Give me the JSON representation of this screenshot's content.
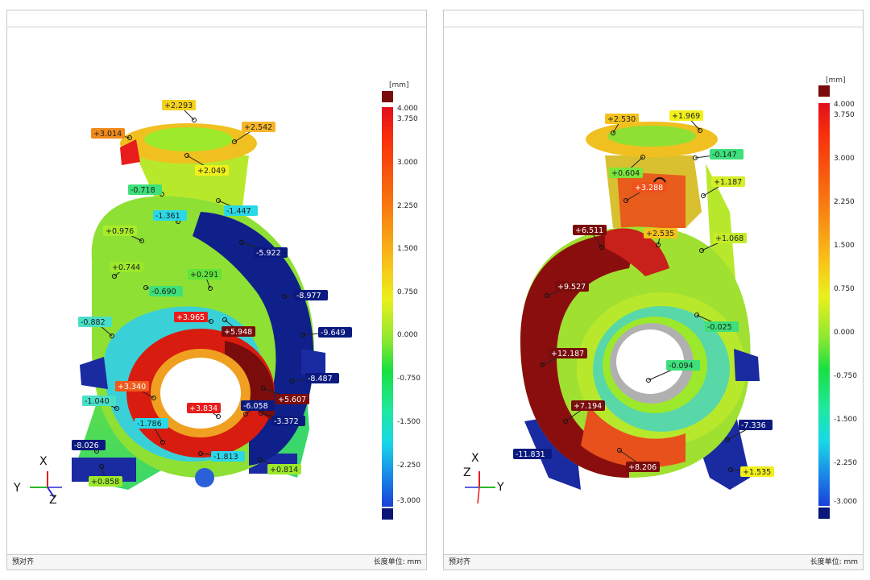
{
  "panels": [
    {
      "footer_left": "预对齐",
      "footer_right": "长度单位: mm",
      "scale": {
        "unit": "[mm]",
        "ticks": [
          "4.000",
          "3.750",
          "3.000",
          "2.250",
          "1.500",
          "0.750",
          "0.000",
          "-0.750",
          "-1.500",
          "-2.250",
          "-3.000"
        ]
      },
      "axes": {
        "up": "X",
        "left": "Y",
        "right": "Z"
      },
      "labels": [
        {
          "text": "+2.293",
          "c": "#f4d21c",
          "tc": "#222"
        },
        {
          "text": "+3.014",
          "c": "#f08a1c",
          "tc": "#222"
        },
        {
          "text": "+2.542",
          "c": "#f6b52a",
          "tc": "#222"
        },
        {
          "text": "+2.049",
          "c": "#f2f01c",
          "tc": "#222"
        },
        {
          "text": "-0.718",
          "c": "#3de07a",
          "tc": "#222"
        },
        {
          "text": "-1.361",
          "c": "#2ad8e8",
          "tc": "#222"
        },
        {
          "text": "-1.447",
          "c": "#2ad8e8",
          "tc": "#222"
        },
        {
          "text": "+0.976",
          "c": "#a8ec2a",
          "tc": "#222"
        },
        {
          "text": "-5.922",
          "c": "#0c1a80",
          "tc": "#fff"
        },
        {
          "text": "+0.744",
          "c": "#9ce82a",
          "tc": "#222"
        },
        {
          "text": "+0.291",
          "c": "#62e43a",
          "tc": "#222"
        },
        {
          "text": "-0.690",
          "c": "#3de07a",
          "tc": "#222"
        },
        {
          "text": "-8.977",
          "c": "#0c1a80",
          "tc": "#fff"
        },
        {
          "text": "-0.882",
          "c": "#48dfc8",
          "tc": "#222"
        },
        {
          "text": "+3.965",
          "c": "#e81c1c",
          "tc": "#fff"
        },
        {
          "text": "+5.948",
          "c": "#7a0c0c",
          "tc": "#fff"
        },
        {
          "text": "-9.649",
          "c": "#0c1a80",
          "tc": "#fff"
        },
        {
          "text": "-8.487",
          "c": "#0c1a80",
          "tc": "#fff"
        },
        {
          "text": "+3.340",
          "c": "#f05a1c",
          "tc": "#fff"
        },
        {
          "text": "+5.607",
          "c": "#7a0c0c",
          "tc": "#fff"
        },
        {
          "text": "-1.040",
          "c": "#48dfc8",
          "tc": "#222"
        },
        {
          "text": "+3.834",
          "c": "#e81c1c",
          "tc": "#fff"
        },
        {
          "text": "-6.058",
          "c": "#0c1a80",
          "tc": "#fff"
        },
        {
          "text": "-3.372",
          "c": "#0c1a80",
          "tc": "#fff"
        },
        {
          "text": "-1.786",
          "c": "#2ad8e8",
          "tc": "#222"
        },
        {
          "text": "-8.026",
          "c": "#0c1a80",
          "tc": "#fff"
        },
        {
          "text": "-1.813",
          "c": "#2ad8e8",
          "tc": "#222"
        },
        {
          "text": "+0.814",
          "c": "#9ce82a",
          "tc": "#222"
        },
        {
          "text": "+0.858",
          "c": "#9ce82a",
          "tc": "#222"
        }
      ]
    },
    {
      "footer_left": "预对齐",
      "footer_right": "长度单位: mm",
      "scale": {
        "unit": "[mm]",
        "ticks": [
          "4.000",
          "3.750",
          "3.000",
          "2.250",
          "1.500",
          "0.750",
          "0.000",
          "-0.750",
          "-1.500",
          "-2.250",
          "-3.000"
        ]
      },
      "axes": {
        "up": "X",
        "left": "Z",
        "right": "Y"
      },
      "labels": [
        {
          "text": "+2.530",
          "c": "#f4c21c",
          "tc": "#222"
        },
        {
          "text": "+1.969",
          "c": "#f2f01c",
          "tc": "#222"
        },
        {
          "text": "-0.147",
          "c": "#3de07a",
          "tc": "#222"
        },
        {
          "text": "+0.604",
          "c": "#7ae63a",
          "tc": "#222"
        },
        {
          "text": "+3.288",
          "c": "#f0501c",
          "tc": "#fff"
        },
        {
          "text": "+1.187",
          "c": "#d6ee2a",
          "tc": "#222"
        },
        {
          "text": "+6.511",
          "c": "#7a0c0c",
          "tc": "#fff"
        },
        {
          "text": "+2.535",
          "c": "#f4c21c",
          "tc": "#222"
        },
        {
          "text": "+1.068",
          "c": "#c4ec2a",
          "tc": "#222"
        },
        {
          "text": "+9.527",
          "c": "#7a0c0c",
          "tc": "#fff"
        },
        {
          "text": "-0.025",
          "c": "#3de07a",
          "tc": "#222"
        },
        {
          "text": "+12.187",
          "c": "#7a0c0c",
          "tc": "#fff"
        },
        {
          "text": "-0.094",
          "c": "#3de07a",
          "tc": "#222"
        },
        {
          "text": "+7.194",
          "c": "#7a0c0c",
          "tc": "#fff"
        },
        {
          "text": "-7.336",
          "c": "#0c1a80",
          "tc": "#fff"
        },
        {
          "text": "-11.831",
          "c": "#0c1a80",
          "tc": "#fff"
        },
        {
          "text": "+8.206",
          "c": "#7a0c0c",
          "tc": "#fff"
        },
        {
          "text": "+1.535",
          "c": "#f2f01c",
          "tc": "#222"
        }
      ]
    }
  ]
}
